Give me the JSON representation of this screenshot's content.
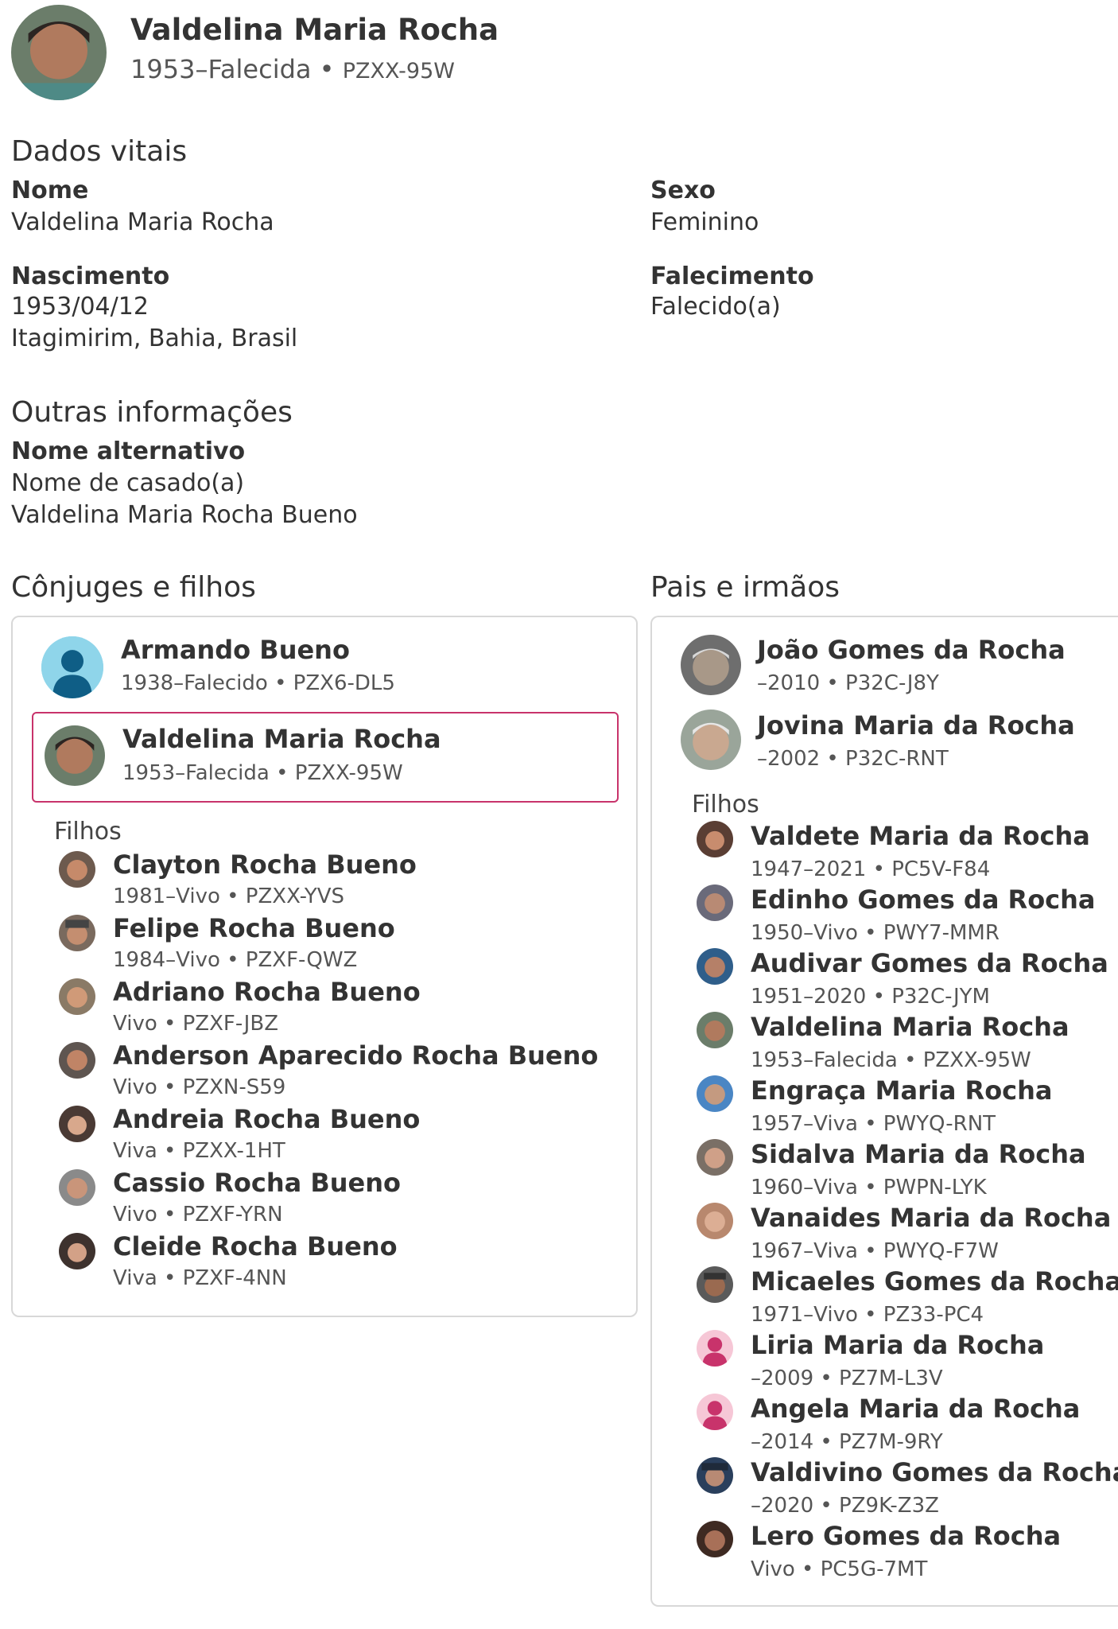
{
  "header": {
    "name": "Valdelina Maria Rocha",
    "lifespan": "1953–Falecida",
    "separator": "•",
    "pid": "PZXX-95W"
  },
  "vital": {
    "title": "Dados vitais",
    "name_label": "Nome",
    "name_value": "Valdelina Maria Rocha",
    "sex_label": "Sexo",
    "sex_value": "Feminino",
    "birth_label": "Nascimento",
    "birth_date": "1953/04/12",
    "birth_place": "Itagimirim, Bahia, Brasil",
    "death_label": "Falecimento",
    "death_value": "Falecido(a)"
  },
  "other": {
    "title": "Outras informações",
    "alt_label": "Nome alternativo",
    "alt_type": "Nome de casado(a)",
    "alt_value": "Valdelina Maria Rocha Bueno"
  },
  "spouses": {
    "title": "Cônjuges e filhos",
    "spouse": {
      "name": "Armando Bueno",
      "sub": "1938–Falecido • PZX6-DL5"
    },
    "self": {
      "name": "Valdelina Maria Rocha",
      "sub": "1953–Falecida • PZXX-95W"
    },
    "children_label": "Filhos",
    "children": [
      {
        "name": "Clayton Rocha Bueno",
        "sub": "1981–Vivo • PZXX-YVS"
      },
      {
        "name": "Felipe Rocha Bueno",
        "sub": "1984–Vivo • PZXF-QWZ"
      },
      {
        "name": "Adriano Rocha Bueno",
        "sub": "Vivo • PZXF-JBZ"
      },
      {
        "name": "Anderson Aparecido Rocha Bueno",
        "sub": "Vivo • PZXN-S59"
      },
      {
        "name": "Andreia Rocha Bueno",
        "sub": "Viva • PZXX-1HT"
      },
      {
        "name": "Cassio Rocha Bueno",
        "sub": "Vivo • PZXF-YRN"
      },
      {
        "name": "Cleide Rocha Bueno",
        "sub": "Viva • PZXF-4NN"
      }
    ]
  },
  "parents": {
    "title": "Pais e irmãos",
    "father": {
      "name": "João Gomes da Rocha",
      "sub": "–2010 • P32C-J8Y"
    },
    "mother": {
      "name": "Jovina Maria da Rocha",
      "sub": "–2002 • P32C-RNT"
    },
    "children_label": "Filhos",
    "children": [
      {
        "name": "Valdete Maria da Rocha",
        "sub": "1947–2021 • PC5V-F84"
      },
      {
        "name": "Edinho Gomes da Rocha",
        "sub": "1950–Vivo • PWY7-MMR"
      },
      {
        "name": "Audivar Gomes da Rocha",
        "sub": "1951–2020 • P32C-JYM"
      },
      {
        "name": "Valdelina Maria Rocha",
        "sub": "1953–Falecida • PZXX-95W"
      },
      {
        "name": "Engraça Maria Rocha",
        "sub": "1957–Viva • PWYQ-RNT"
      },
      {
        "name": "Sidalva Maria da Rocha",
        "sub": "1960–Viva • PWPN-LYK"
      },
      {
        "name": "Vanaides Maria da Rocha",
        "sub": "1967–Viva • PWYQ-F7W"
      },
      {
        "name": "Micaeles Gomes da Rocha",
        "sub": "1971–Vivo • PZ33-PC4"
      },
      {
        "name": "Liria Maria da Rocha",
        "sub": "–2009 • PZ7M-L3V"
      },
      {
        "name": "Angela Maria da Rocha",
        "sub": "–2014 • PZ7M-9RY"
      },
      {
        "name": "Valdivino Gomes da Rocha",
        "sub": "–2020 • PZ9K-Z3Z"
      },
      {
        "name": "Lero Gomes da Rocha",
        "sub": "Vivo • PC5G-7MT"
      }
    ]
  },
  "colors": {
    "highlight_border": "#c8336b",
    "female_placeholder": "#c8336b",
    "male_placeholder": "#2a7fb0"
  }
}
